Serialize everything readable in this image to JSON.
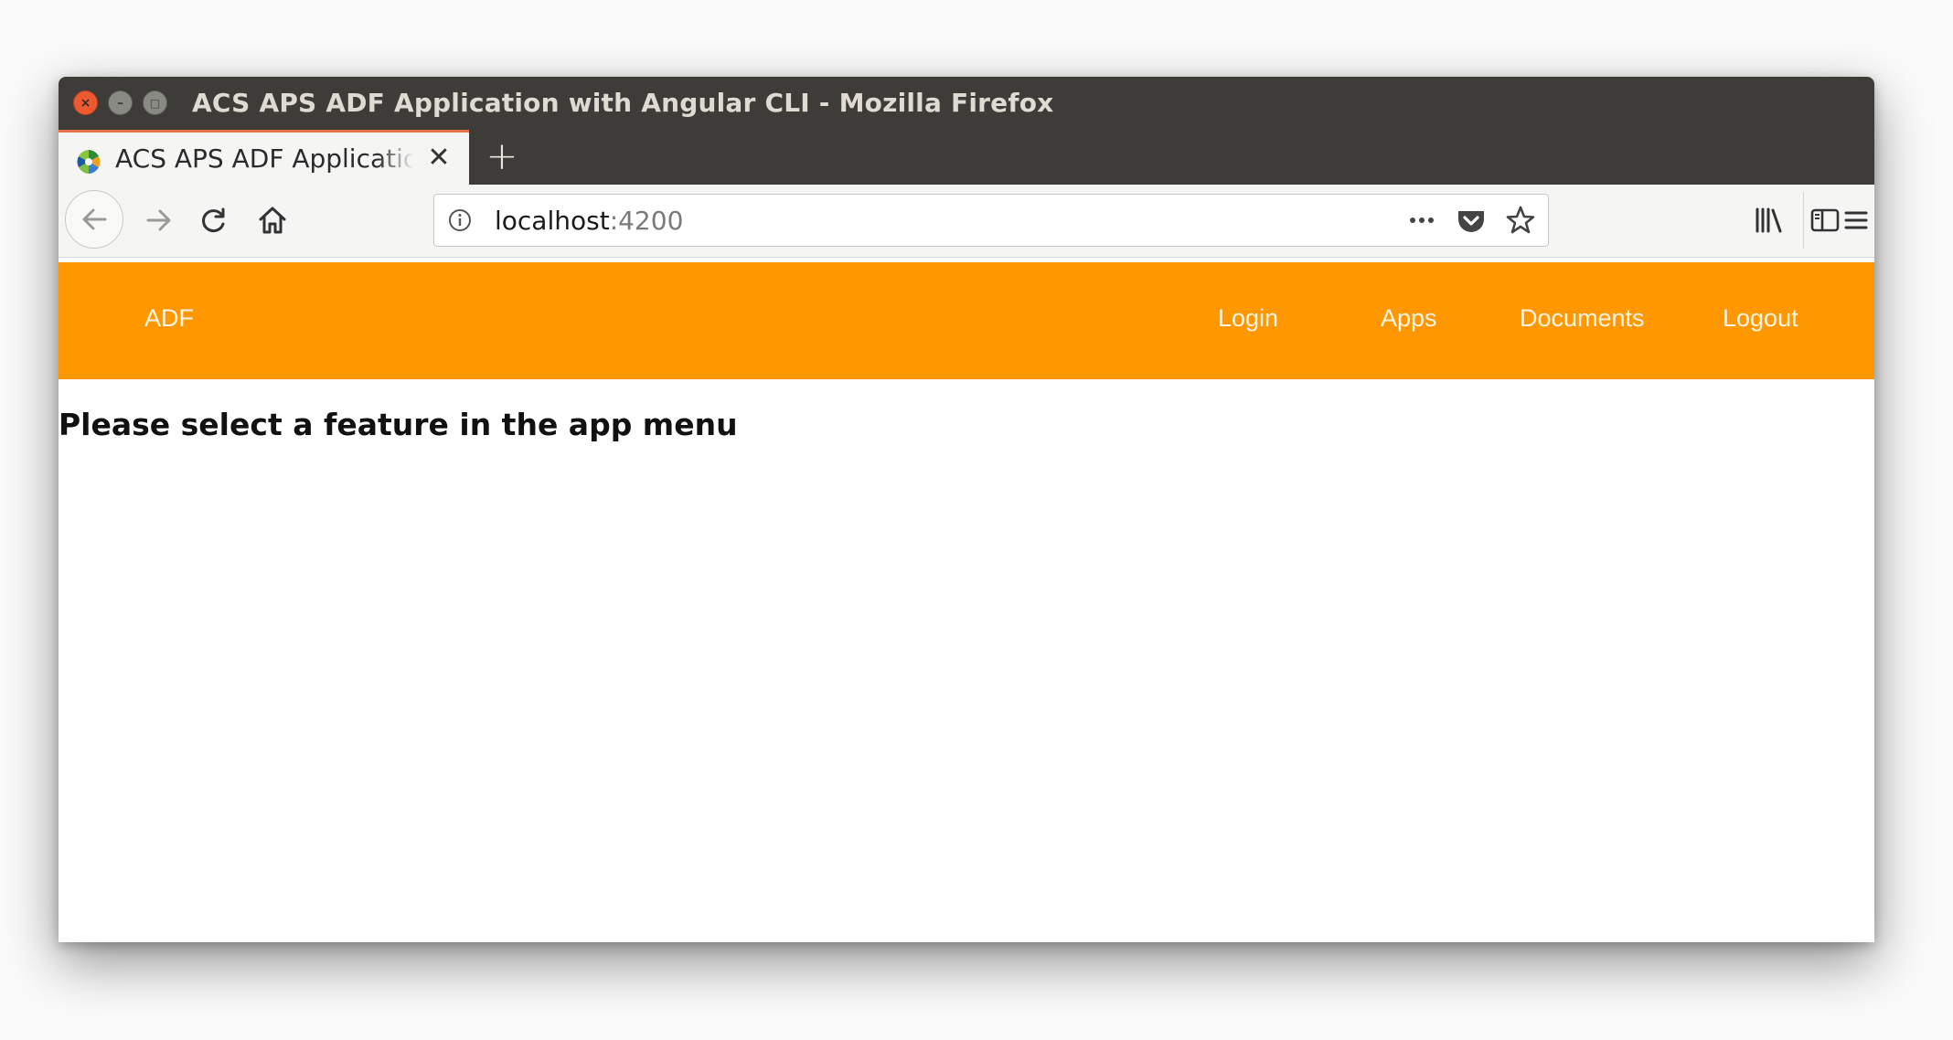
{
  "window": {
    "title": "ACS APS ADF Application with Angular CLI - Mozilla Firefox"
  },
  "tabs": [
    {
      "label": "ACS APS ADF Application with Angular CLI",
      "active": true
    }
  ],
  "new_tab_symbol": "+",
  "tab_close_symbol": "✕",
  "toolbar": {
    "icons": [
      "back-icon",
      "forward-icon",
      "reload-icon",
      "home-icon",
      "library-icon",
      "sidebar-icon",
      "menu-icon"
    ]
  },
  "urlbar": {
    "host": "localhost",
    "port": ":4200",
    "icons": [
      "info-icon",
      "page-actions-icon",
      "pocket-icon",
      "bookmark-star-icon"
    ]
  },
  "app": {
    "brand": "ADF",
    "nav": {
      "login": "Login",
      "apps": "Apps",
      "documents": "Documents",
      "logout": "Logout"
    },
    "message": "Please select a feature in the app menu"
  },
  "colors": {
    "titlebar": "#3d3c38",
    "app_header": "#ff9800",
    "tab_accent": "#e8724a",
    "close_button": "#ee5a30"
  }
}
